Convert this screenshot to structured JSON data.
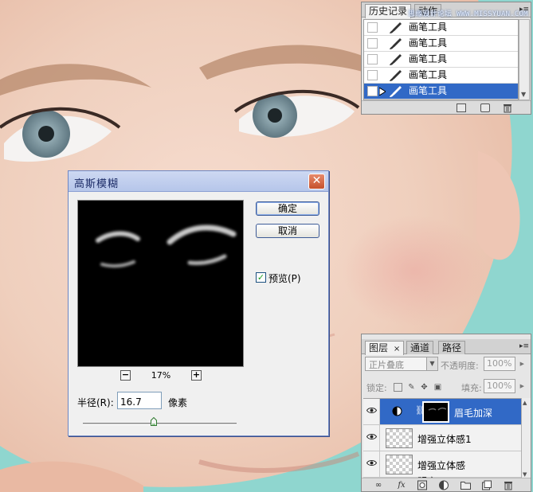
{
  "watermark": "思缘设计论坛 WWW.MISSYUAN.COM",
  "history_panel": {
    "tabs": [
      {
        "label": "历史记录"
      },
      {
        "label": "动作"
      }
    ],
    "menu_icon": "panel-menu-icon",
    "items": [
      {
        "label": "画笔工具",
        "icon": "brush-icon",
        "selected": false
      },
      {
        "label": "画笔工具",
        "icon": "brush-icon",
        "selected": false
      },
      {
        "label": "画笔工具",
        "icon": "brush-icon",
        "selected": false
      },
      {
        "label": "画笔工具",
        "icon": "brush-icon",
        "selected": false
      },
      {
        "label": "画笔工具",
        "icon": "brush-icon",
        "selected": true
      }
    ],
    "footer_icons": [
      "new-document-from-state-icon",
      "snapshot-icon",
      "trash-icon"
    ]
  },
  "dialog": {
    "title": "高斯模糊",
    "ok_label": "确定",
    "cancel_label": "取消",
    "preview_label": "预览(P)",
    "preview_checked": true,
    "zoom_out": "−",
    "zoom_in": "+",
    "zoom_value": "17%",
    "radius_label": "半径(R):",
    "radius_value": "16.7",
    "radius_unit": "像素",
    "radius_slider_fraction": 0.46
  },
  "layers_panel": {
    "tabs": [
      {
        "label": "图层"
      },
      {
        "label": "通道"
      },
      {
        "label": "路径"
      }
    ],
    "blend_mode": "正片叠底",
    "opacity_label": "不透明度:",
    "opacity_value": "100%",
    "lock_label": "锁定:",
    "fill_label": "填充:",
    "fill_value": "100%",
    "layers": [
      {
        "name": "眉毛加深",
        "selected": true
      },
      {
        "name": "增强立体感1",
        "selected": false
      },
      {
        "name": "增强立体感",
        "selected": false
      },
      {
        "name": "明亮",
        "selected": false
      }
    ],
    "footer_icons": [
      "link-icon",
      "fx-icon",
      "mask-icon",
      "adjustment-icon",
      "group-icon",
      "new-layer-icon",
      "trash-icon"
    ]
  }
}
